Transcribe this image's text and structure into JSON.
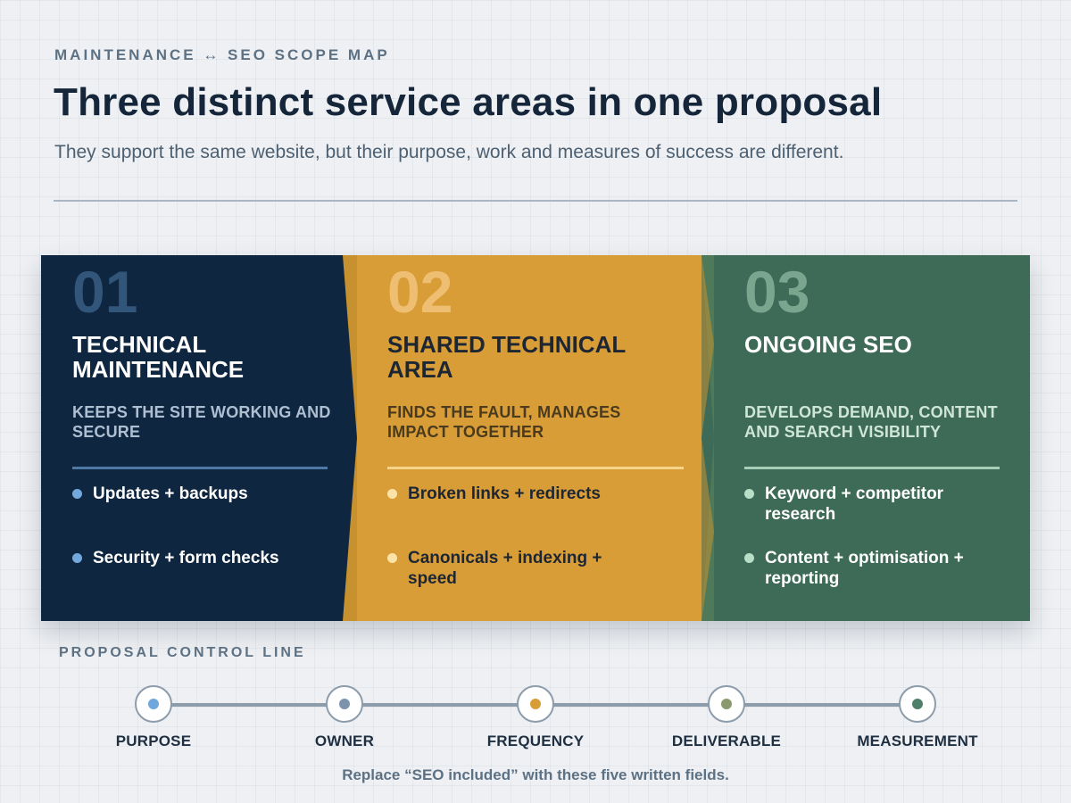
{
  "header": {
    "eyebrow": "MAINTENANCE ↔ SEO SCOPE MAP",
    "title": "Three distinct service areas in one proposal",
    "subtitle": "They support the same website, but their purpose, work and measures of success are different."
  },
  "colors": {
    "maintenance": "#0f2640",
    "shared": "#d99d38",
    "seo": "#3e6b58"
  },
  "panels": [
    {
      "number": "01",
      "title": "TECHNICAL MAINTENANCE",
      "subtitle": "KEEPS THE SITE WORKING AND SECURE",
      "items": [
        "Updates + backups",
        "Security + form checks"
      ]
    },
    {
      "number": "02",
      "title": "SHARED TECHNICAL AREA",
      "subtitle": "FINDS THE FAULT, MANAGES IMPACT TOGETHER",
      "items": [
        "Broken links + redirects",
        "Canonicals + indexing + speed"
      ]
    },
    {
      "number": "03",
      "title": "ONGOING SEO",
      "subtitle": "DEVELOPS DEMAND, CONTENT AND SEARCH VISIBILITY",
      "items": [
        "Keyword + competitor research",
        "Content + optimisation + reporting"
      ]
    }
  ],
  "control_line": {
    "label": "PROPOSAL CONTROL LINE",
    "steps": [
      {
        "label": "PURPOSE",
        "color": "#6fa7dc"
      },
      {
        "label": "OWNER",
        "color": "#7b93ab"
      },
      {
        "label": "FREQUENCY",
        "color": "#d99d38"
      },
      {
        "label": "DELIVERABLE",
        "color": "#8a9a6e"
      },
      {
        "label": "MEASUREMENT",
        "color": "#4f7f68"
      }
    ],
    "footnote": "Replace “SEO included” with these five written fields."
  }
}
